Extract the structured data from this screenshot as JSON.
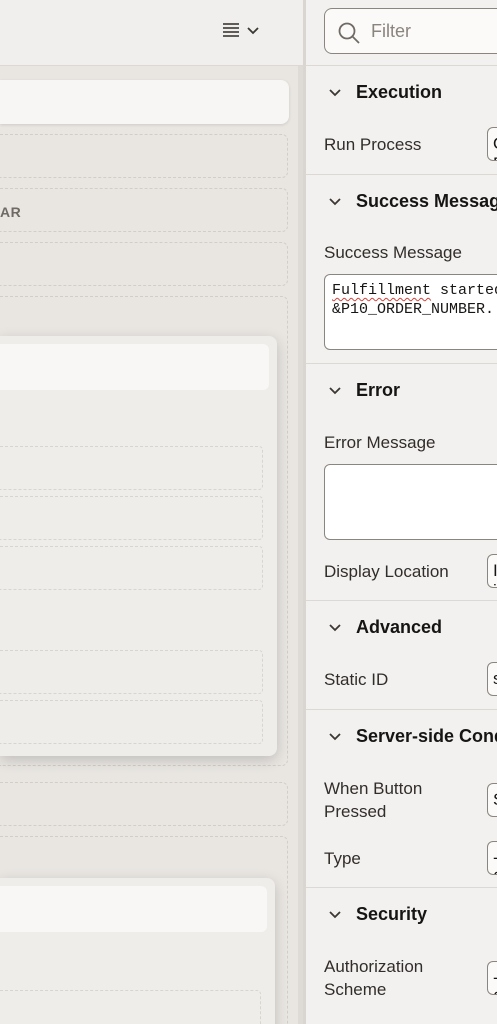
{
  "canvas": {
    "toolbar": {
      "menu_icon": "list-lines-icon",
      "chevron_icon": "chevron-down-icon"
    },
    "region_label_fragment": "AR"
  },
  "filter": {
    "placeholder": "Filter",
    "value": "",
    "icon": "search-icon"
  },
  "sections": {
    "execution": {
      "title": "Execution",
      "run_process_label": "Run Process",
      "run_process_value": "Once Per Page Visit (default)"
    },
    "success_message": {
      "title": "Success Message",
      "label": "Success Message",
      "value_line1_word": "Fulfillment",
      "value_line1_rest": " started for order",
      "value_line2": "&P10_ORDER_NUMBER."
    },
    "error": {
      "title": "Error",
      "error_message_label": "Error Message",
      "error_message_value": "",
      "display_location_label": "Display Location",
      "display_location_value": "Inline in Notification"
    },
    "advanced": {
      "title": "Advanced",
      "static_id_label": "Static ID",
      "static_id_value": "start_fulfillment"
    },
    "server_side": {
      "title": "Server-side Condition",
      "when_button_label_1": "When Button",
      "when_button_label_2": "Pressed",
      "when_button_value": "START_FULFILLMENT",
      "type_label": "Type",
      "type_value": "- Select -"
    },
    "security": {
      "title": "Security",
      "auth_label_1": "Authorization",
      "auth_label_2": "Scheme",
      "auth_value": "- Select -"
    }
  },
  "colors": {
    "panel_bg": "#f3f1ef",
    "canvas_bg": "#e9e6e2",
    "text": "#161513",
    "border": "#8b857f",
    "spellcheck": "#d0443c"
  }
}
